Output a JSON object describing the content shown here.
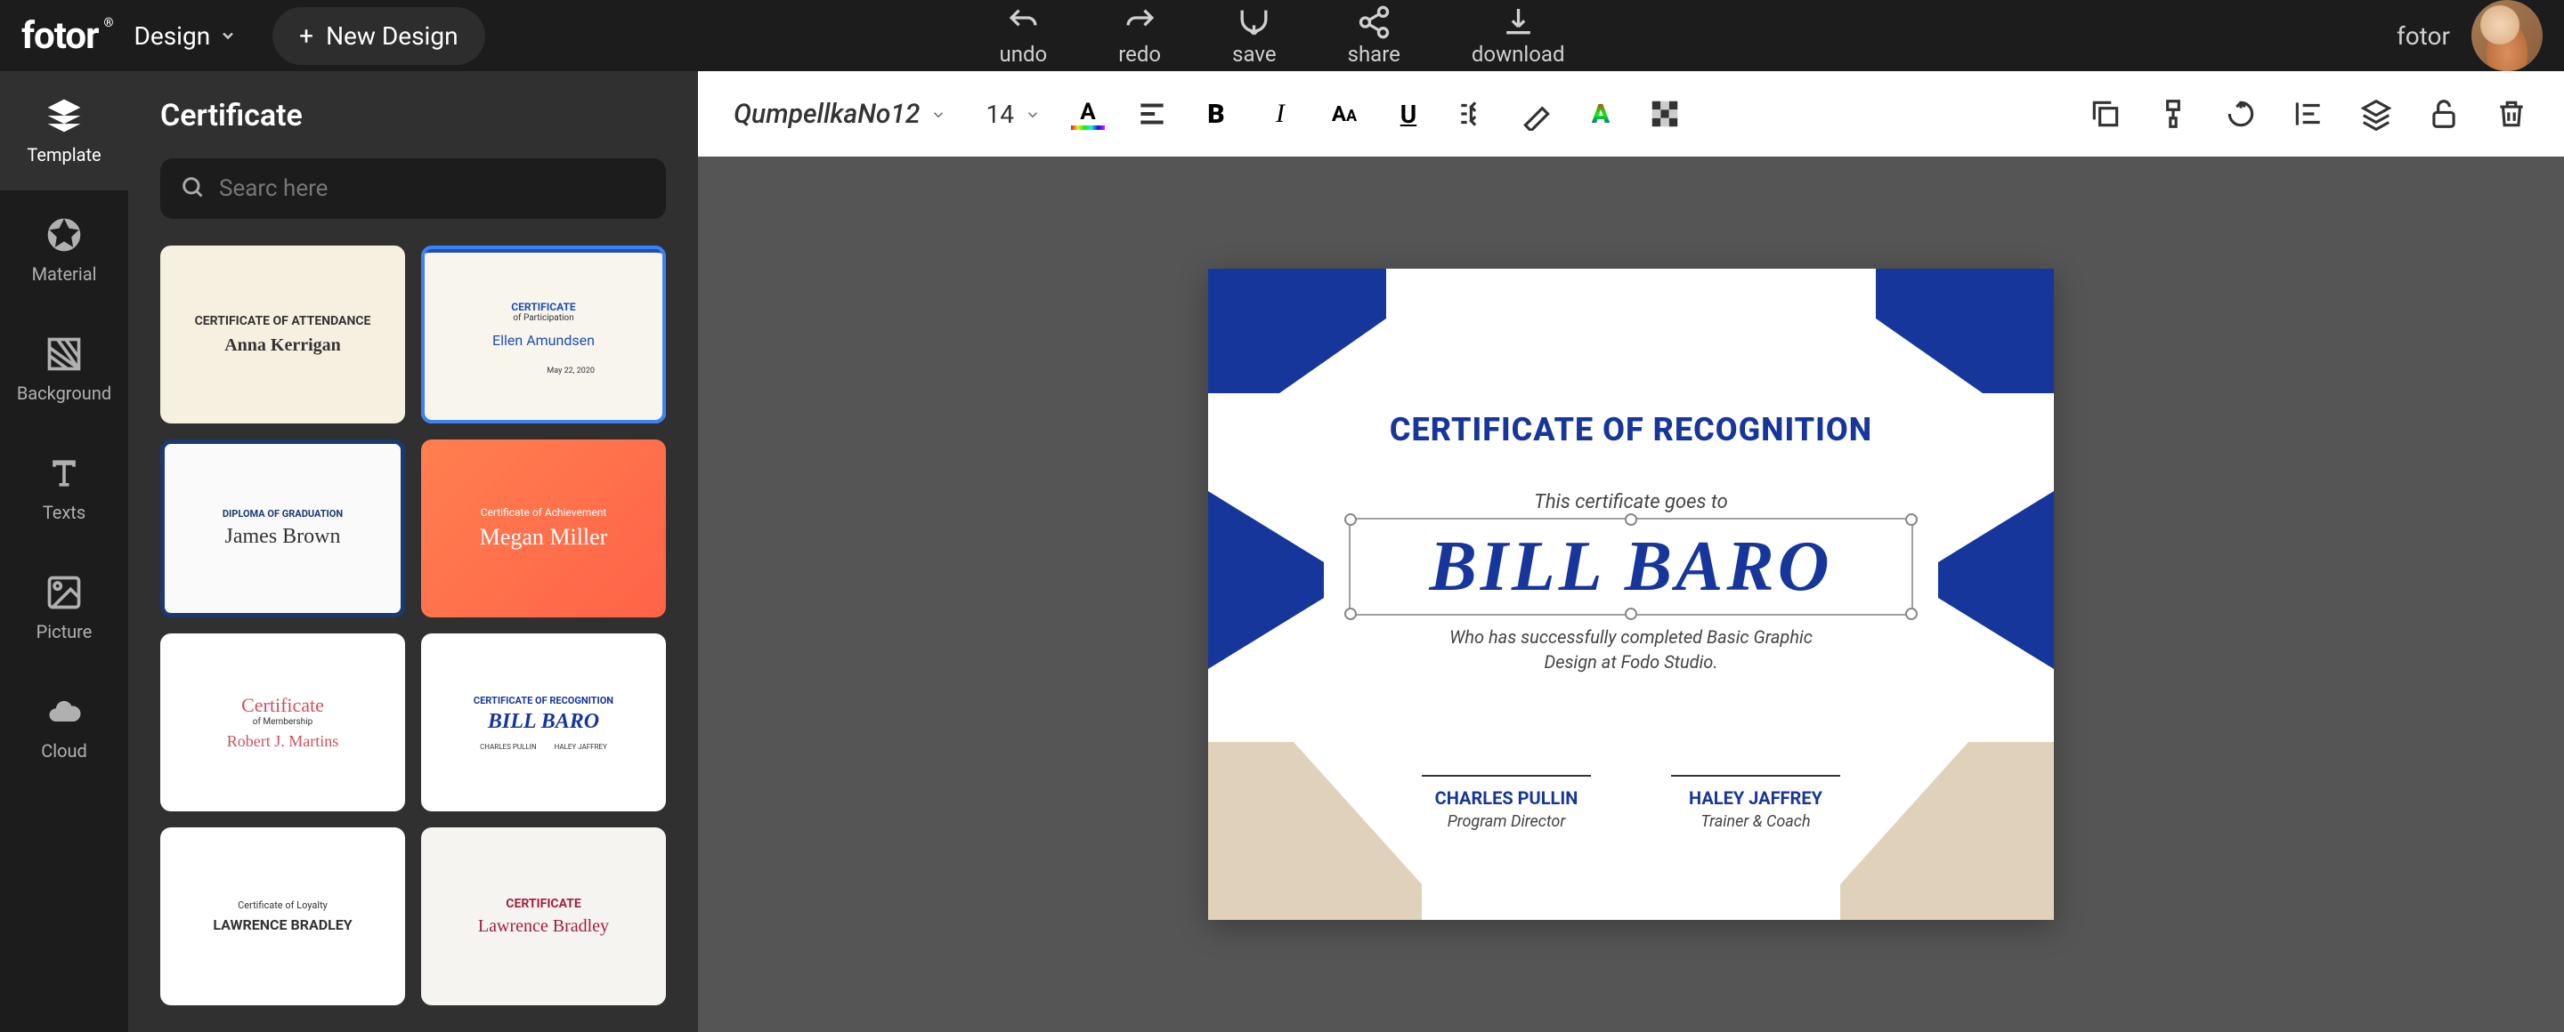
{
  "topbar": {
    "logo": "fotor",
    "design_label": "Design",
    "new_design_label": "New Design",
    "actions": {
      "undo": "undo",
      "redo": "redo",
      "save": "save",
      "share": "share",
      "download": "download"
    },
    "brand_link": "fotor"
  },
  "nav": {
    "items": [
      {
        "label": "Template"
      },
      {
        "label": "Material"
      },
      {
        "label": "Background"
      },
      {
        "label": "Texts"
      },
      {
        "label": "Picture"
      },
      {
        "label": "Cloud"
      }
    ]
  },
  "panel": {
    "title": "Certificate",
    "search_placeholder": "Searc here",
    "templates": [
      {
        "title": "CERTIFICATE OF ATTENDANCE",
        "name": "Anna Kerrigan"
      },
      {
        "title": "CERTIFICATE",
        "sub": "of Participation",
        "name": "Ellen Amundsen",
        "date": "May 22, 2020"
      },
      {
        "title": "DIPLOMA OF GRADUATION",
        "name": "James Brown"
      },
      {
        "title": "Certificate of Achievement",
        "name": "Megan Miller"
      },
      {
        "title": "Certificate",
        "sub": "of Membership",
        "name": "Robert J. Martins"
      },
      {
        "title": "CERTIFICATE OF RECOGNITION",
        "name": "BILL BARO",
        "s1": "CHARLES PULLIN",
        "s2": "HALEY JAFFREY"
      },
      {
        "title": "Certificate of Loyalty",
        "name": "LAWRENCE BRADLEY"
      },
      {
        "title": "CERTIFICATE",
        "name": "Lawrence Bradley"
      }
    ]
  },
  "text_toolbar": {
    "font": "QumpellkaNo12",
    "size": "14"
  },
  "certificate": {
    "heading": "CERTIFICATE OF RECOGNITION",
    "subheading": "This certificate goes to",
    "recipient": "BILL BARO",
    "description": "Who has successfully completed Basic Graphic\nDesign at Fodo Studio.",
    "signatures": [
      {
        "name": "CHARLES PULLIN",
        "role": "Program Director"
      },
      {
        "name": "HALEY JAFFREY",
        "role": "Trainer & Coach"
      }
    ]
  }
}
